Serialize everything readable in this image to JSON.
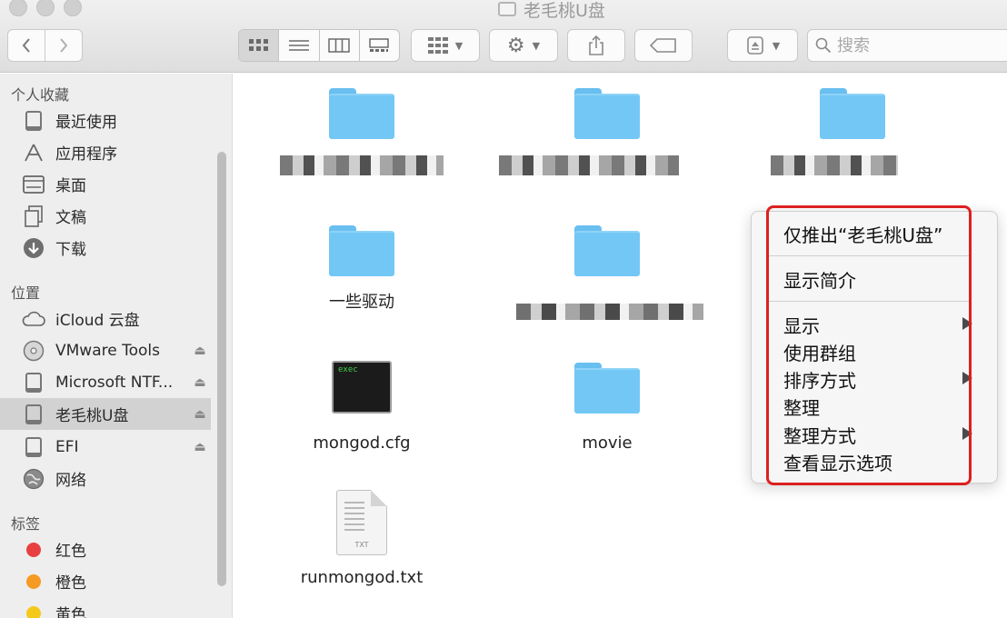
{
  "window": {
    "title": "老毛桃U盘"
  },
  "toolbar": {
    "back_icon": "chevron-left-icon",
    "forward_icon": "chevron-right-icon",
    "view_modes": [
      "icon-view",
      "list-view",
      "column-view",
      "gallery-view"
    ],
    "group_icon": "group-icon",
    "action_icon": "gear-icon",
    "share_icon": "share-icon",
    "tag_icon": "tag-icon",
    "eject_icon": "eject-icon",
    "search_placeholder": "搜索"
  },
  "sidebar": {
    "favorites_heading": "个人收藏",
    "favorites": [
      {
        "label": "最近使用",
        "icon": "clock-icon"
      },
      {
        "label": "应用程序",
        "icon": "applications-icon"
      },
      {
        "label": "桌面",
        "icon": "desktop-icon"
      },
      {
        "label": "文稿",
        "icon": "documents-icon"
      },
      {
        "label": "下载",
        "icon": "download-icon"
      }
    ],
    "locations_heading": "位置",
    "locations": [
      {
        "label": "iCloud 云盘",
        "icon": "cloud-icon",
        "eject": false
      },
      {
        "label": "VMware Tools",
        "icon": "disc-icon",
        "eject": true
      },
      {
        "label": "Microsoft NTF...",
        "icon": "disk-icon",
        "eject": true
      },
      {
        "label": "老毛桃U盘",
        "icon": "disk-icon",
        "eject": true,
        "selected": true
      },
      {
        "label": "EFI",
        "icon": "disk-icon",
        "eject": true
      },
      {
        "label": "网络",
        "icon": "network-icon",
        "eject": false
      }
    ],
    "tags_heading": "标签",
    "tags": [
      {
        "label": "红色",
        "color": "#e84040"
      },
      {
        "label": "橙色",
        "color": "#f59a23"
      },
      {
        "label": "黄色",
        "color": "#f5c91a"
      }
    ]
  },
  "content": {
    "items": [
      {
        "name": "",
        "type": "folder",
        "obscured": true
      },
      {
        "name": "",
        "type": "folder",
        "obscured": true
      },
      {
        "name": "",
        "type": "folder",
        "obscured": true
      },
      {
        "name": "一些驱动",
        "type": "folder"
      },
      {
        "name": "",
        "type": "folder",
        "obscured": true
      },
      {
        "name": "mongod.cfg",
        "type": "terminal-file",
        "icon_text": "exec"
      },
      {
        "name": "movie",
        "type": "folder"
      },
      {
        "name": "runmongod.txt",
        "type": "text-file",
        "icon_text": "TXT"
      }
    ]
  },
  "context_menu": {
    "items": [
      {
        "label": "仅推出“老毛桃U盘”",
        "submenu": false
      },
      {
        "label": "显示简介",
        "submenu": false
      },
      {
        "label": "显示",
        "submenu": true
      },
      {
        "label": "使用群组",
        "submenu": false
      },
      {
        "label": "排序方式",
        "submenu": true
      },
      {
        "label": "整理",
        "submenu": false
      },
      {
        "label": "整理方式",
        "submenu": true
      },
      {
        "label": "查看显示选项",
        "submenu": false
      }
    ],
    "highlight_color": "#dd2020"
  }
}
